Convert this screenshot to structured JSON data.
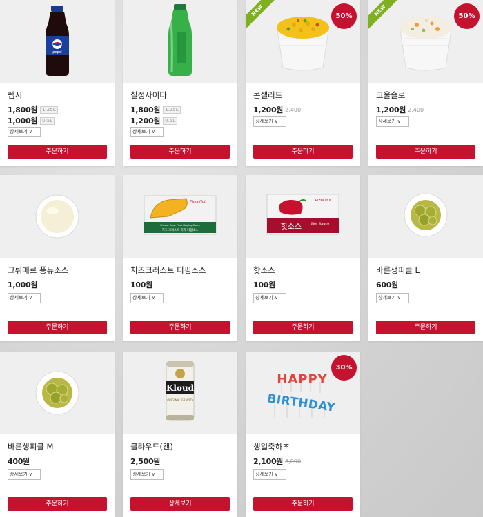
{
  "common": {
    "detail_label": "상세보기",
    "order_label": "주문하기"
  },
  "products": [
    {
      "name": "펩시",
      "prices": [
        {
          "price": "1,800원",
          "tag": "1.25L"
        },
        {
          "price": "1,000원",
          "tag": "0.5L"
        }
      ],
      "action": "주문하기",
      "image": "pepsi-bottle"
    },
    {
      "name": "칠성사이다",
      "prices": [
        {
          "price": "1,800원",
          "tag": "1.25L"
        },
        {
          "price": "1,200원",
          "tag": "0.5L"
        }
      ],
      "action": "주문하기",
      "image": "cider-bottle"
    },
    {
      "name": "콘샐러드",
      "prices": [
        {
          "price": "1,200원",
          "old": "2,400"
        }
      ],
      "action": "주문하기",
      "badge": "50%",
      "ribbon": "NEW",
      "image": "corn-salad-cup"
    },
    {
      "name": "코울슬로",
      "prices": [
        {
          "price": "1,200원",
          "old": "2,400"
        }
      ],
      "action": "주문하기",
      "badge": "50%",
      "ribbon": "NEW",
      "image": "coleslaw-cup"
    },
    {
      "name": "그뤼에르 퐁듀소스",
      "prices": [
        {
          "price": "1,000원"
        }
      ],
      "action": "주문하기",
      "image": "fondue-sauce-bowl"
    },
    {
      "name": "치즈크러스트 디핑소스",
      "prices": [
        {
          "price": "100원"
        }
      ],
      "action": "주문하기",
      "image": "dipping-sauce-packet",
      "packet_text": "치즈 크러스트 피자 디핑소스",
      "packet_text_en": "Cheese Crust Pizza Dipping Sauce",
      "brand": "Pizza Hut"
    },
    {
      "name": "핫소스",
      "prices": [
        {
          "price": "100원"
        }
      ],
      "action": "주문하기",
      "image": "hot-sauce-packet",
      "packet_text": "핫소스",
      "packet_text_en": "Hot Sauce",
      "brand": "Pizza Hut"
    },
    {
      "name": "바른생피클 L",
      "prices": [
        {
          "price": "600원"
        }
      ],
      "action": "주문하기",
      "image": "pickle-bowl-large"
    },
    {
      "name": "바른생피클 M",
      "prices": [
        {
          "price": "400원"
        }
      ],
      "action": "주문하기",
      "image": "pickle-bowl-medium"
    },
    {
      "name": "클라우드(캔)",
      "prices": [
        {
          "price": "2,500원"
        }
      ],
      "action": "상세보기",
      "image": "kloud-beer-can",
      "can_brand": "Kloud",
      "can_text": "ORIGINAL GRAVITY"
    },
    {
      "name": "생일축하초",
      "prices": [
        {
          "price": "2,100원",
          "old": "3,000"
        }
      ],
      "action": "주문하기",
      "badge": "30%",
      "image": "birthday-candles",
      "candle_line1": "HAPPY",
      "candle_line2": "BIRTHDAY"
    }
  ],
  "colors": {
    "brand_red": "#c4122f",
    "new_green": "#7fb020"
  }
}
